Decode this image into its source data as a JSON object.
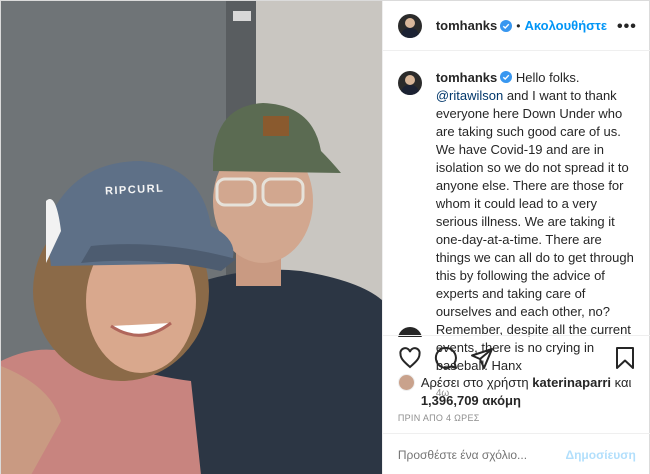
{
  "header": {
    "username": "tomhanks",
    "separator": "•",
    "follow_label": "Ακολουθήστε",
    "more_label": "•••"
  },
  "photo": {
    "cap_text": "RIPCURL"
  },
  "caption": {
    "username": "tomhanks",
    "text_before": "Hello folks. ",
    "mention": "@ritawilson",
    "text_after": " and I want to thank everyone here Down Under who are taking such good care of us. We have Covid-19 and are in isolation so we do not spread it to anyone else. There are those for whom it could lead to a very serious illness. We are taking it one-day-at-a-time. There are things we can all do to get through this by following the advice of experts and taking care of ourselves and each other, no? Remember, despite all the current events, there is no crying in baseball. Hanx",
    "age": "4ω"
  },
  "actions": {
    "like_icon": "heart-icon",
    "comment_icon": "comment-icon",
    "share_icon": "share-icon",
    "save_icon": "bookmark-icon"
  },
  "likes": {
    "prefix": "Αρέσει στο χρήστη ",
    "liker": "katerinaparri",
    "mid": " και",
    "count_text": "1,396,709 ακόμη"
  },
  "timestamp": "ΠΡΙΝ ΑΠΟ 4 ΩΡΕΣ",
  "comment": {
    "placeholder": "Προσθέστε ένα σχόλιο...",
    "post_label": "Δημοσίευση"
  },
  "colors": {
    "accent": "#0095f6",
    "verified": "#3897f0",
    "post_disabled": "#b2dffc"
  }
}
